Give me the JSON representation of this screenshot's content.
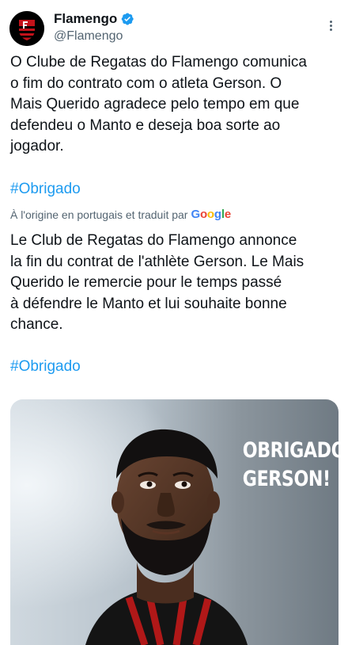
{
  "account": {
    "name": "Flamengo",
    "handle": "@Flamengo",
    "verified": true
  },
  "tweet": {
    "original_text": "O Clube de Regatas do Flamengo comunica\no fim do contrato com o atleta Gerson. O\nMais Querido agradece pelo tempo em que\ndefendeu o Manto e deseja boa sorte ao\njogador.",
    "hashtag": "#Obrigado",
    "translation_note_prefix": "À l'origine en portugais et traduit par",
    "translation_provider": "Google",
    "translated_text": "Le Club de Regatas do Flamengo annonce\nla fin du contrat de l'athlète Gerson. Le Mais\nQuerido le remercie pour le temps passé\nà défendre le Manto et lui souhaite bonne\nchance.",
    "translated_hashtag": "#Obrigado"
  },
  "media": {
    "overlay_text_line1": "OBRIGADO,",
    "overlay_text_line2": "GERSON!"
  },
  "colors": {
    "link": "#1d9bf0",
    "verified": "#1d9bf0",
    "club_red": "#c4121a",
    "club_black": "#000000"
  },
  "icons": {
    "avatar": "flamengo-crest-icon",
    "verified": "verified-badge-icon",
    "more": "more-options-icon"
  }
}
